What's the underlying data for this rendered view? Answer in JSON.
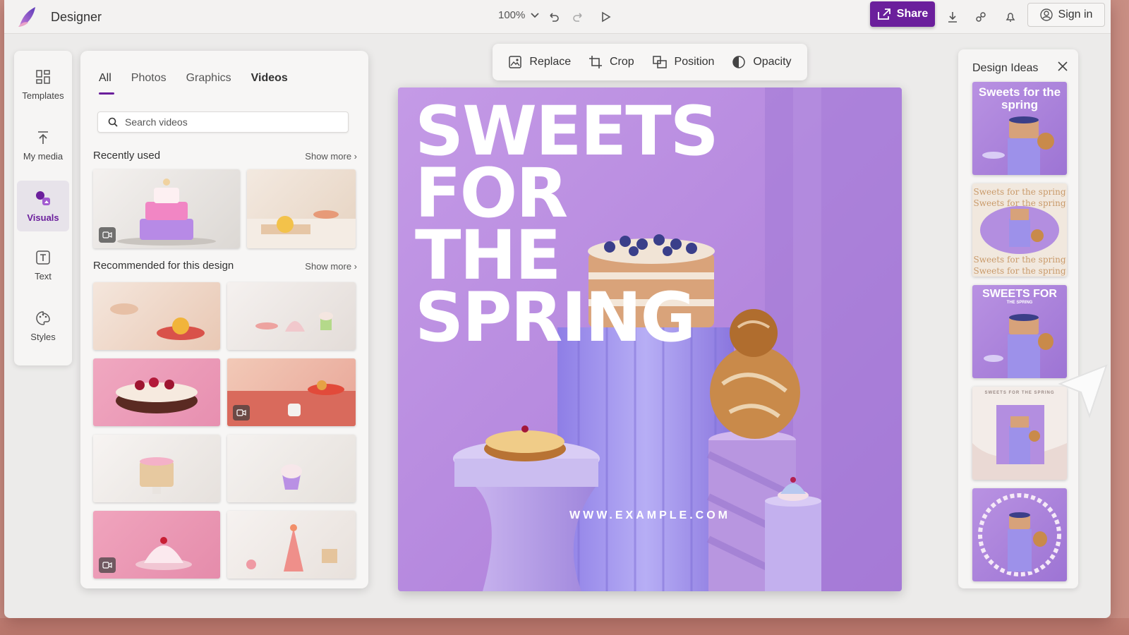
{
  "app": {
    "name": "Designer"
  },
  "topbar": {
    "zoom": "100%",
    "share_label": "Share",
    "signin_label": "Sign in"
  },
  "rail": [
    {
      "label": "Templates",
      "icon": "templates-icon"
    },
    {
      "label": "My media",
      "icon": "upload-icon"
    },
    {
      "label": "Visuals",
      "icon": "visuals-icon"
    },
    {
      "label": "Text",
      "icon": "text-icon"
    },
    {
      "label": "Styles",
      "icon": "styles-icon"
    }
  ],
  "panel": {
    "tabs": [
      "All",
      "Photos",
      "Graphics",
      "Videos"
    ],
    "search_placeholder": "Search videos",
    "recent_title": "Recently used",
    "recommended_title": "Recommended for this design",
    "show_more": "Show more"
  },
  "toolbar": {
    "replace": "Replace",
    "crop": "Crop",
    "position": "Position",
    "opacity": "Opacity"
  },
  "canvas": {
    "headline": [
      "SWEETS",
      "FOR",
      "THE",
      "SPRING"
    ],
    "url": "WWW.EXAMPLE.COM"
  },
  "ideas": {
    "title": "Design Ideas",
    "card1": "Sweets for the spring",
    "card2_line": "Sweets for the spring",
    "card3": "SWEETS FOR",
    "card3_sub": "THE SPRING",
    "card4_line": "SWEETS FOR THE SPRING"
  },
  "colors": {
    "accent": "#6b1f9c",
    "canvas_bg": "#b98fe0"
  }
}
